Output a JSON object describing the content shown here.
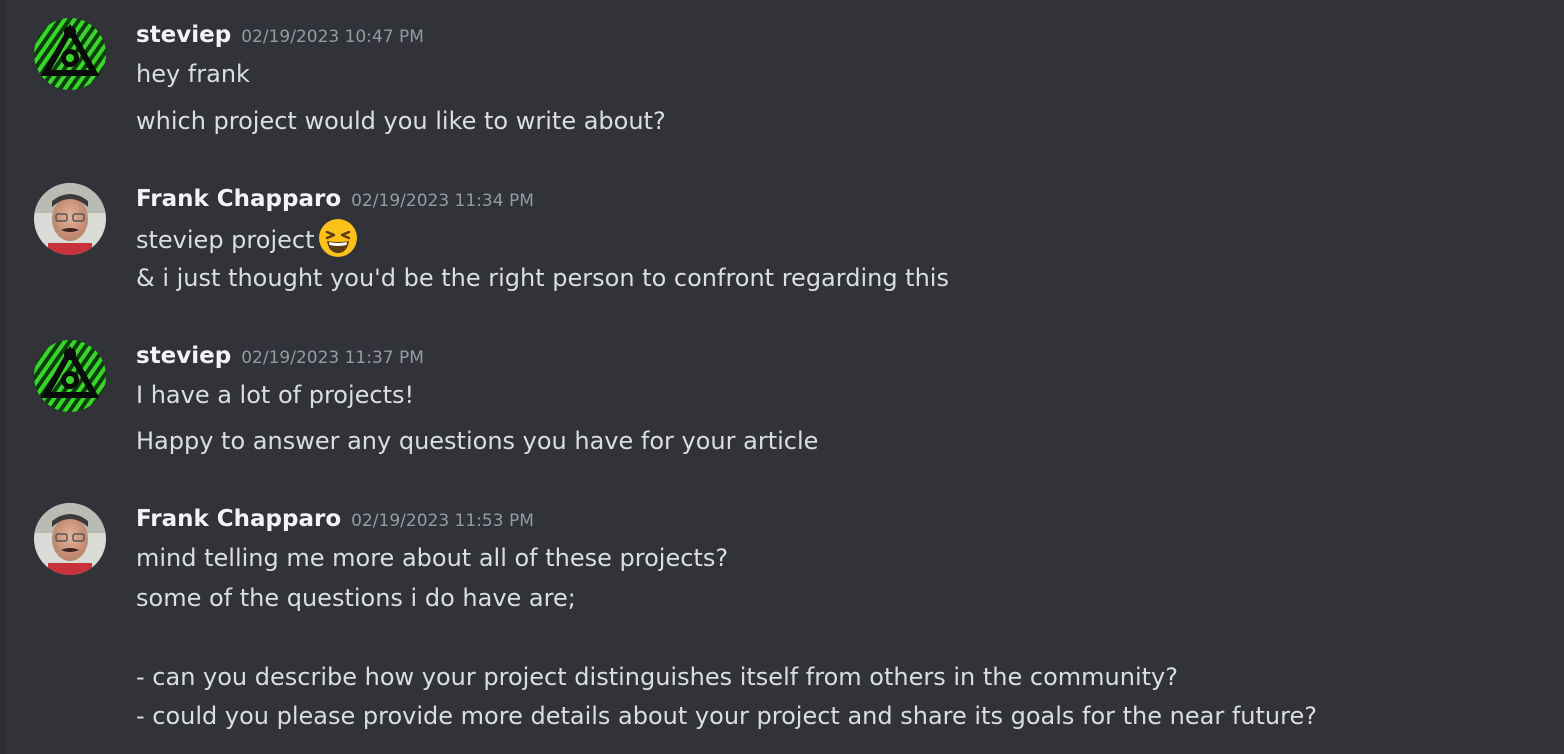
{
  "messages": [
    {
      "author": "steviep",
      "timestamp": "02/19/2023 10:47 PM",
      "avatar_icon": "green-triangle-eye-avatar",
      "lines": [
        "hey frank",
        "which project would you like to write about?"
      ]
    },
    {
      "author": "Frank Chapparo",
      "timestamp": "02/19/2023 11:34 PM",
      "avatar_icon": "person-photo-avatar",
      "lines": [
        "steviep project",
        "& i just thought you'd be the right person to confront regarding this"
      ],
      "emoji": "grinning-squinting-face-icon"
    },
    {
      "author": "steviep",
      "timestamp": "02/19/2023 11:37 PM",
      "avatar_icon": "green-triangle-eye-avatar",
      "lines": [
        "I have a lot of projects!",
        "Happy to answer any questions you have for your article"
      ]
    },
    {
      "author": "Frank Chapparo",
      "timestamp": "02/19/2023 11:53 PM",
      "avatar_icon": "person-photo-avatar",
      "lines": [
        "mind telling me more about all of these projects?",
        "some of the questions i do have are;",
        "- can you describe how your project distinguishes itself from others in the community?",
        "- could you please provide more details about your project and share its goals for the near future?"
      ]
    }
  ],
  "colors": {
    "background": "#313338",
    "username": "#f2f3f5",
    "timestamp": "#949ba4",
    "text": "#dbdee1"
  }
}
